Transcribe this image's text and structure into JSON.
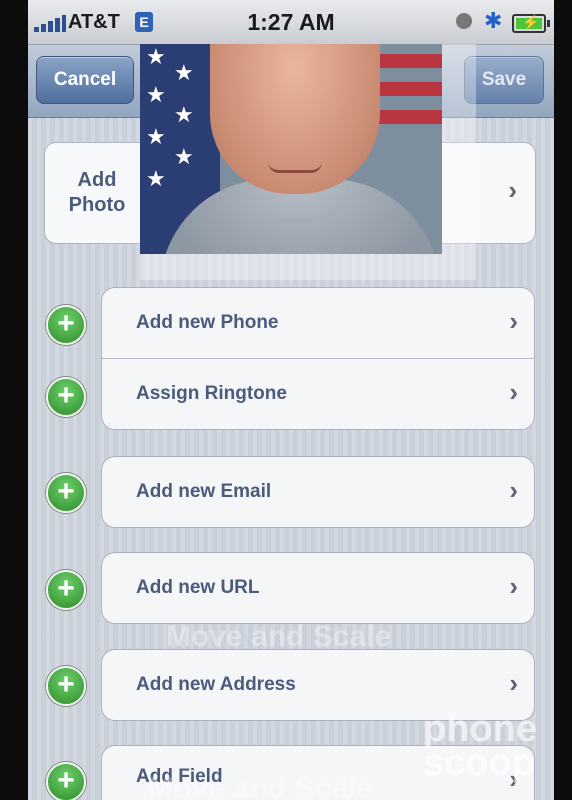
{
  "status_bar": {
    "carrier": "AT&T",
    "network": "E",
    "time": "1:27 AM",
    "bluetooth_icon": "bluetooth-icon",
    "battery_icon": "battery-charging-icon"
  },
  "nav": {
    "cancel_label": "Cancel",
    "save_label": "Save"
  },
  "photo": {
    "add_label": "Add Photo"
  },
  "fields": {
    "phone": "Add new Phone",
    "ringtone": "Assign Ringtone",
    "email": "Add new Email",
    "url": "Add new URL",
    "address": "Add new Address",
    "field": "Add Field"
  },
  "overlay": {
    "move_scale_1": "Move and Scale",
    "move_scale_2": "Move and Scale"
  },
  "watermark": {
    "line1": "phone",
    "line2": "scoop"
  },
  "colors": {
    "accent": "#4b5b7b",
    "plus": "#2c8c2b",
    "nav": "#93a6bf"
  }
}
